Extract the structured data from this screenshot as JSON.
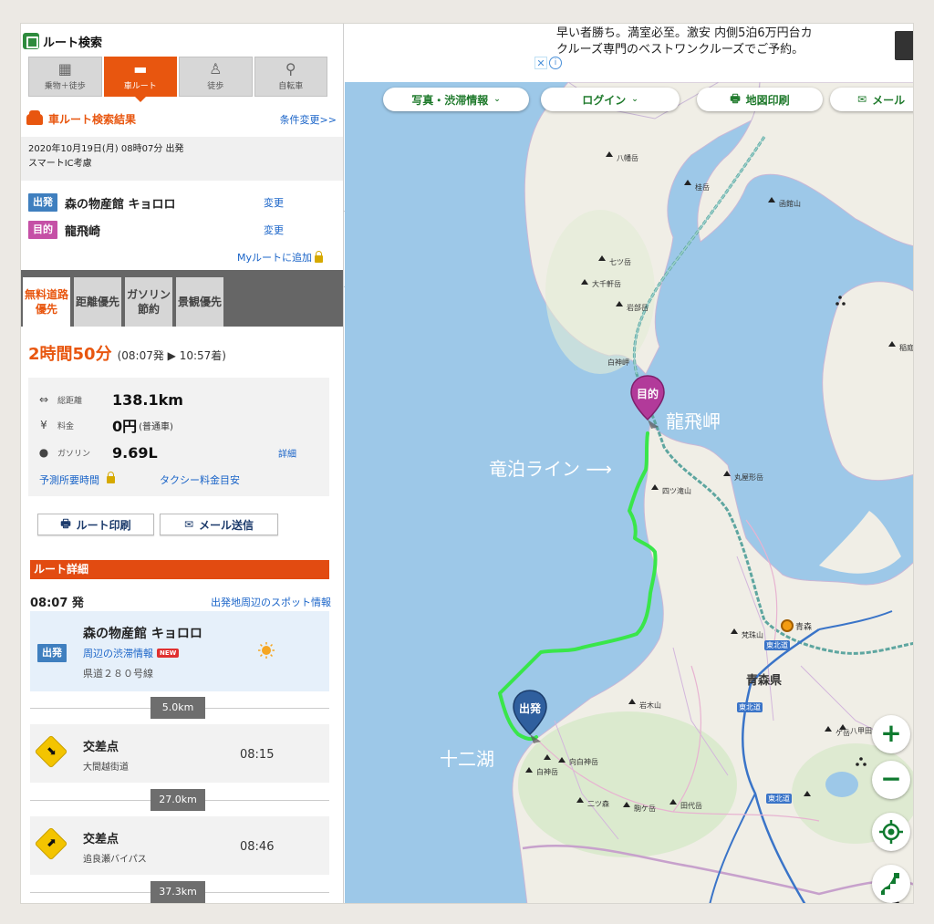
{
  "panel": {
    "title": "ルート検索",
    "modes": [
      {
        "label": "乗物＋徒歩",
        "icon": "building-icon"
      },
      {
        "label": "車ルート",
        "icon": "car-icon"
      },
      {
        "label": "徒歩",
        "icon": "walker-icon"
      },
      {
        "label": "自転車",
        "icon": "bicycle-icon"
      }
    ],
    "result_title": "車ルート検索結果",
    "change_conditions": "条件変更>>",
    "date": "2020年10月19日(月) 08時07分 出発",
    "smart_ic": "スマートIC考慮",
    "start_tag": "出発",
    "start_name": "森の物産館 キョロロ",
    "goal_tag": "目的",
    "goal_name": "龍飛崎",
    "change": "変更",
    "my_route": "Myルートに追加",
    "priority_tabs": [
      "無料道路優先",
      "距離優先",
      "ガソリン節約",
      "景観優先"
    ],
    "duration": "2時間50分",
    "duration_detail": "(08:07発 ▶ 10:57着)",
    "stats": {
      "distance_label": "総距離",
      "distance_value": "138.1km",
      "fee_label": "料金",
      "fee_value": "0円",
      "fee_note": "(普通車)",
      "gas_label": "ガソリン",
      "gas_value": "9.69L",
      "details": "詳細",
      "predicted_time": "予測所要時間",
      "taxi_fare": "タクシー料金目安"
    },
    "print_btn": "ルート印刷",
    "mail_btn": "メール送信",
    "route_detail": "ルート詳細",
    "dep_time": "08:07 発",
    "spots_link": "出発地周辺のスポット情報",
    "start_box": {
      "tag": "出発",
      "name": "森の物産館 キョロロ",
      "traffic": "周辺の渋滞情報",
      "new_badge": "NEW",
      "road": "県道２８０号線"
    },
    "distances": [
      "5.0km",
      "27.0km",
      "37.3km"
    ],
    "steps": [
      {
        "name": "交差点",
        "road": "大間越街道",
        "time": "08:15",
        "arrow": "⬊"
      },
      {
        "name": "交差点",
        "road": "追良瀬バイパス",
        "time": "08:46",
        "arrow": "⬈"
      }
    ]
  },
  "ad": {
    "line1": "早い者勝ち。満室必至。激安 内側5泊6万円台カ",
    "line2": "クルーズ専門のベストワンクルーズでご予約。",
    "close": "✕",
    "info": "i"
  },
  "map": {
    "toolbar": {
      "photo_traffic": "写真・渋滞情報",
      "login": "ログイン",
      "print": "地図印刷",
      "mail": "メール"
    },
    "zoom_in": "+",
    "zoom_out": "−",
    "pin_goal": "目的",
    "pin_start": "出発",
    "annotations": {
      "cape": "龍飛岬",
      "line": "竜泊ライン ⟶",
      "lake": "十二湖"
    },
    "prefecture": "青森県",
    "city": "青森",
    "road_labels": [
      "東北道",
      "東北道",
      "東北道"
    ],
    "mountains": [
      "八幡岳",
      "桂岳",
      "函館山",
      "七ツ岳",
      "大千軒岳",
      "岩部岳",
      "白神岬",
      "丸屋形岳",
      "四ツ滝山",
      "梵珠山",
      "岩木山",
      "向白神岳",
      "白神岳",
      "二ツ森",
      "駒ケ岳",
      "田代岳",
      "八甲田山",
      "ゲ岳",
      "中岳",
      "稲庭岳"
    ],
    "colors": {
      "route": "#39e64a",
      "sea": "#9dc8e8",
      "land": "#f0eee6",
      "accent": "#e8560f"
    }
  }
}
